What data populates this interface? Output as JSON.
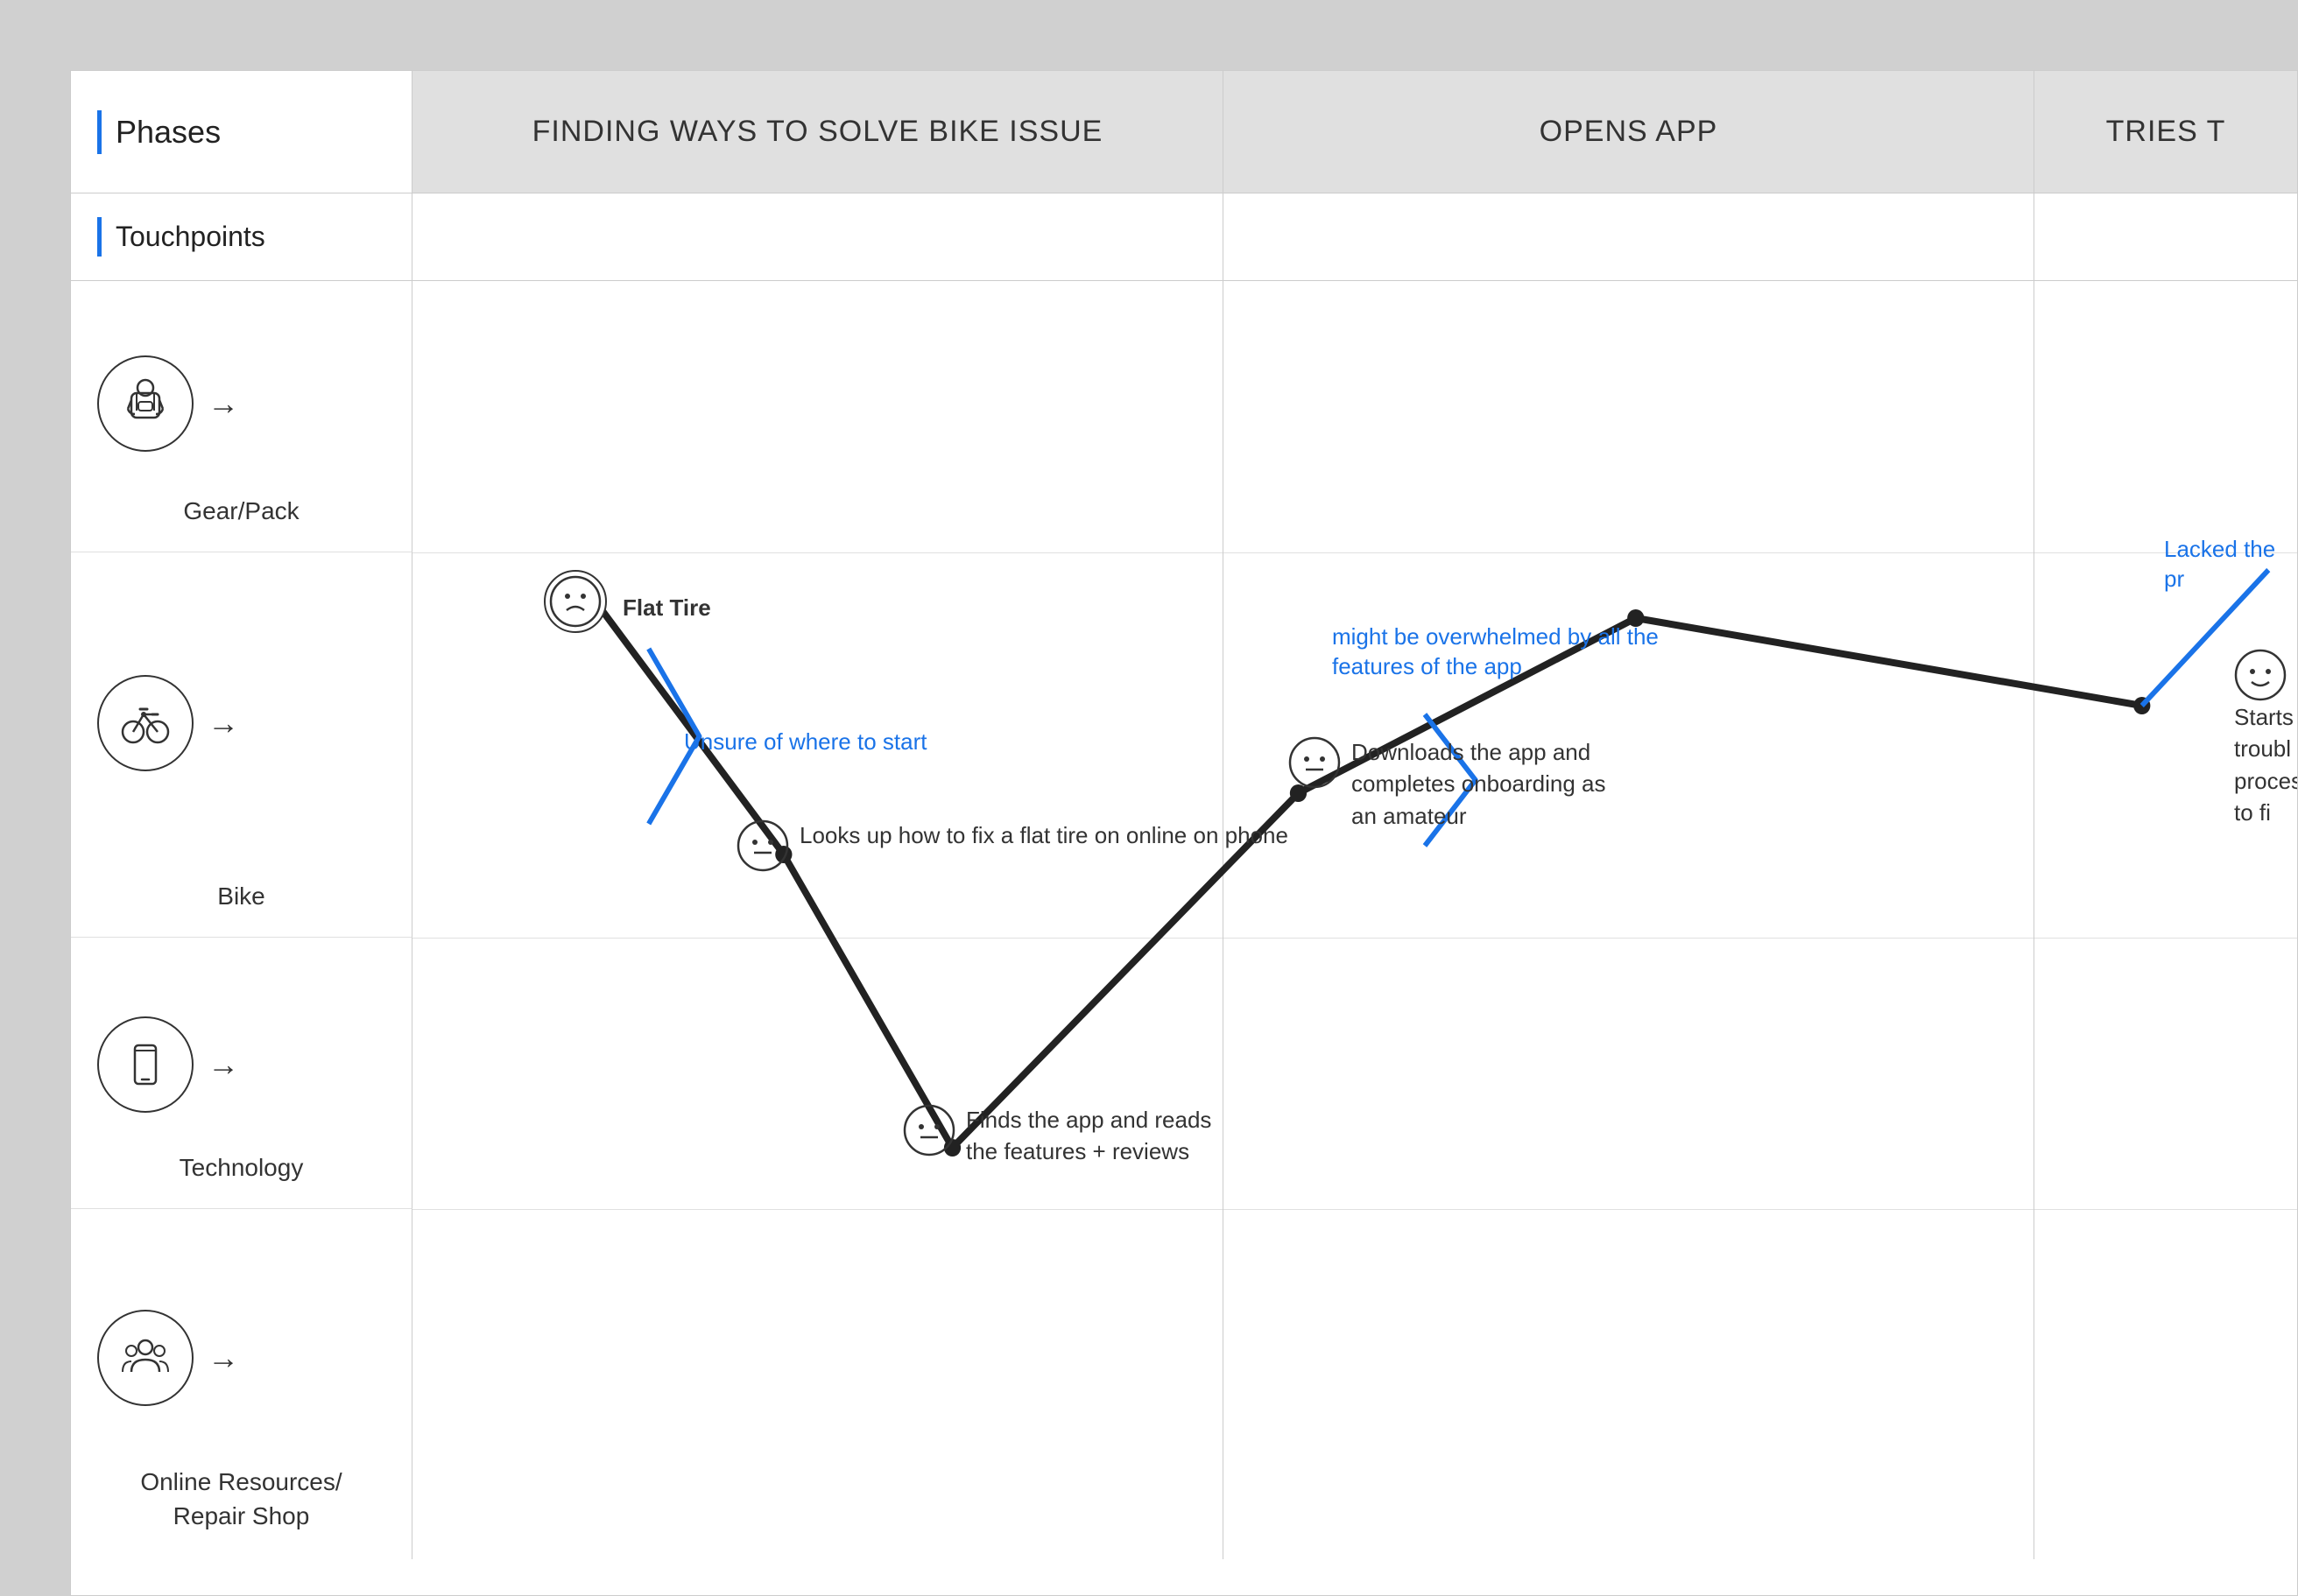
{
  "header": {
    "phases_label": "Phases",
    "touchpoints_label": "Touchpoints",
    "columns": [
      {
        "title": "FINDING WAYS TO SOLVE BIKE ISSUE"
      },
      {
        "title": "OPENS APP"
      },
      {
        "title": "TRIES T"
      }
    ]
  },
  "sidebar": {
    "rows": [
      {
        "icon": "gear-pack",
        "label": "Gear/Pack"
      },
      {
        "icon": "bike",
        "label": "Bike"
      },
      {
        "icon": "technology",
        "label": "Technology"
      },
      {
        "icon": "online-resources",
        "label": "Online Resources/\nRepair Shop"
      }
    ]
  },
  "annotations": {
    "flat_tire": "Flat Tire",
    "unsure_start": "Unsure of where to start",
    "looks_up": "Looks up how to fix a flat\ntire on online on phone",
    "finds_app": "Finds the app and reads\nthe features + reviews",
    "downloads_app": "Downloads the app and\ncompletes onboarding as\nan amateur",
    "overwhelmed": "might be overwhelmed by all the\nfeatures of the app",
    "starts_trouble": "Starts troubl\nprocess to fi",
    "lacked_pr": "Lacked the pr"
  },
  "colors": {
    "blue": "#1a73e8",
    "black": "#222222",
    "gray_bg": "#e0e0e0",
    "border": "#cccccc"
  }
}
